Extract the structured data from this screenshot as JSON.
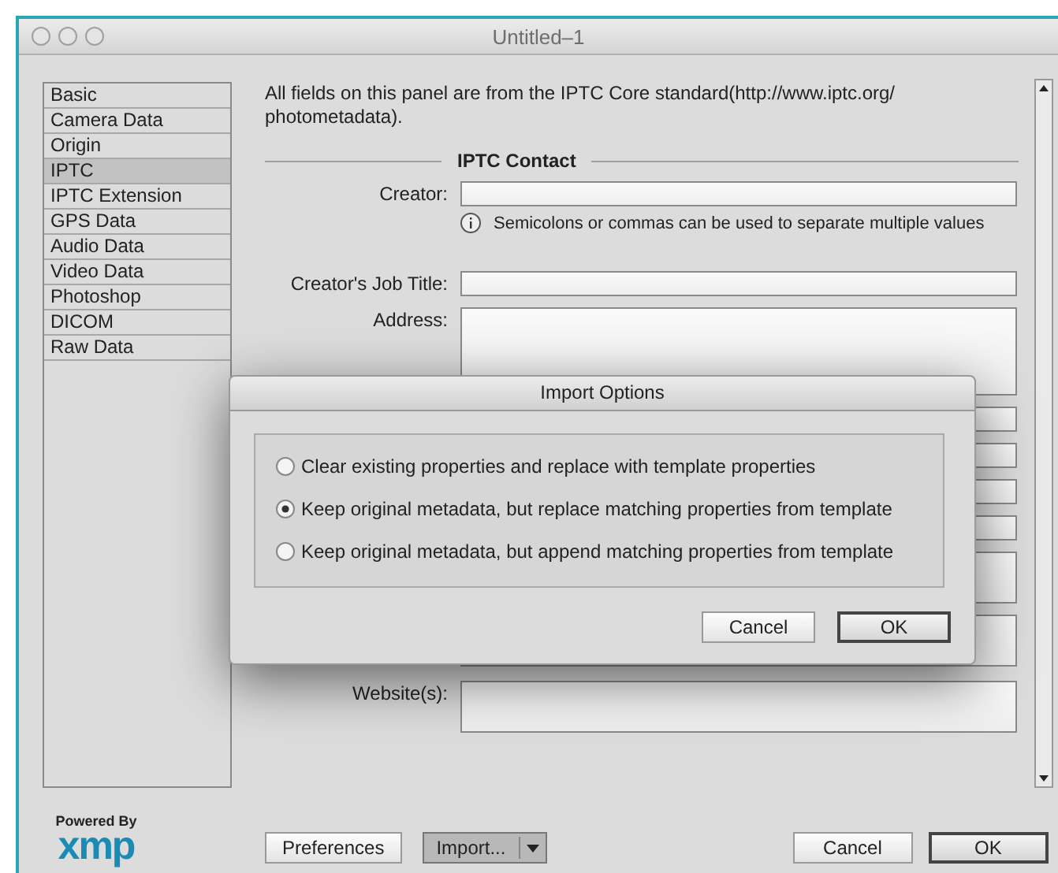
{
  "window": {
    "title": "Untitled–1"
  },
  "sidebar": {
    "items": [
      {
        "label": "Basic",
        "selected": false
      },
      {
        "label": "Camera Data",
        "selected": false
      },
      {
        "label": "Origin",
        "selected": false
      },
      {
        "label": "IPTC",
        "selected": true
      },
      {
        "label": "IPTC Extension",
        "selected": false
      },
      {
        "label": "GPS Data",
        "selected": false
      },
      {
        "label": "Audio Data",
        "selected": false
      },
      {
        "label": "Video Data",
        "selected": false
      },
      {
        "label": "Photoshop",
        "selected": false
      },
      {
        "label": "DICOM",
        "selected": false
      },
      {
        "label": "Raw Data",
        "selected": false
      }
    ]
  },
  "panel": {
    "intro": "All fields on this panel are from the IPTC Core standard(http://www.iptc.org/ photometadata).",
    "section": "IPTC Contact",
    "fields": [
      {
        "kind": "line",
        "label": "Creator:",
        "hint": "Semicolons or commas can be used to separate multiple values"
      },
      {
        "kind": "line",
        "label": "Creator's Job Title:"
      },
      {
        "kind": "area",
        "label": "Address:"
      },
      {
        "kind": "line"
      },
      {
        "kind": "line"
      },
      {
        "kind": "line"
      },
      {
        "kind": "line"
      },
      {
        "kind": "area"
      },
      {
        "kind": "area"
      },
      {
        "kind": "area",
        "label": "Website(s):"
      }
    ]
  },
  "footer": {
    "logo_caption": "Powered By",
    "logo": "xmp",
    "buttons": [
      {
        "label": "Preferences",
        "kind": "plain",
        "default": false
      },
      {
        "label": "Import...",
        "kind": "split"
      },
      {
        "label": "Cancel",
        "kind": "plain",
        "default": false
      },
      {
        "label": "OK",
        "kind": "plain",
        "default": true
      }
    ]
  },
  "dialog": {
    "title": "Import Options",
    "options": [
      {
        "label": "Clear existing properties and replace with template properties",
        "selected": false
      },
      {
        "label": "Keep original metadata, but replace matching properties from template",
        "selected": true
      },
      {
        "label": "Keep original metadata, but append matching properties from template",
        "selected": false
      }
    ],
    "buttons": [
      {
        "label": "Cancel",
        "default": false
      },
      {
        "label": "OK",
        "default": true
      }
    ]
  }
}
